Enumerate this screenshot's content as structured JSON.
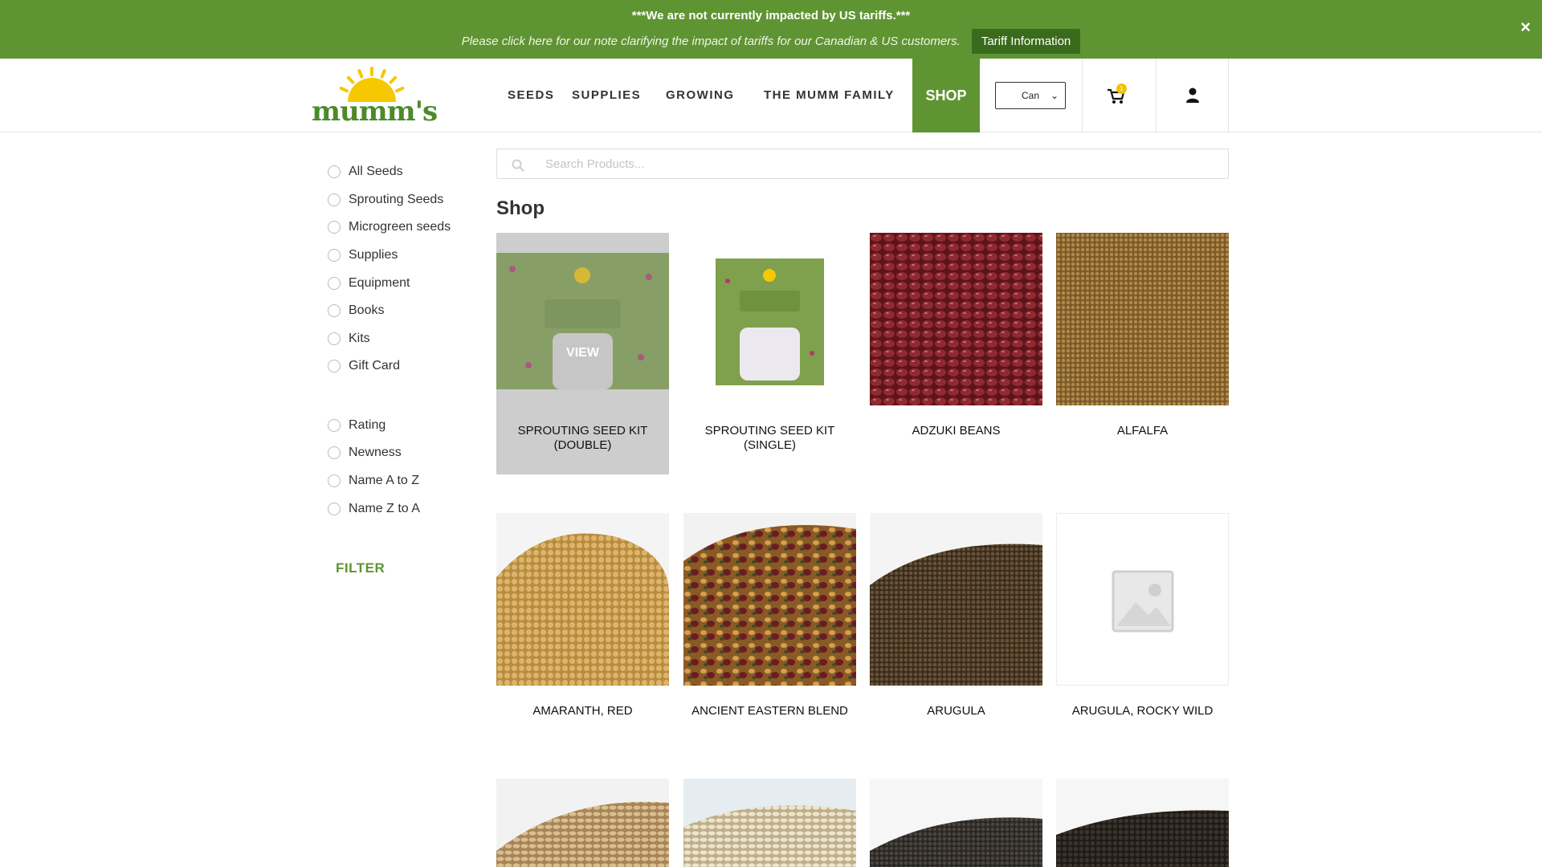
{
  "banner": {
    "headline": "***We are not currently impacted by US tariffs.***",
    "note": "Please click here for our note clarifying the impact of tariffs for our Canadian & US customers.",
    "button": "Tariff Information",
    "close": "×"
  },
  "header": {
    "logo": "mumm's",
    "nav": [
      "SEEDS",
      "SUPPLIES",
      "GROWING",
      "THE MUMM FAMILY"
    ],
    "shop": "SHOP",
    "country": "Can",
    "cart_count": "1"
  },
  "sidebar": {
    "categories": [
      "All Seeds",
      "Sprouting Seeds",
      "Microgreen seeds",
      "Supplies",
      "Equipment",
      "Books",
      "Kits",
      "Gift Card"
    ],
    "sort": [
      "Rating",
      "Newness",
      "Name A to Z",
      "Name Z to A"
    ],
    "filter": "FILTER"
  },
  "search": {
    "placeholder": "Search Products..."
  },
  "main": {
    "title": "Shop",
    "view_label": "VIEW",
    "products": [
      {
        "line1": "SPROUTING SEED KIT",
        "line2": "(DOUBLE)"
      },
      {
        "line1": "SPROUTING SEED KIT",
        "line2": "(SINGLE)"
      },
      {
        "line1": "ADZUKI BEANS",
        "line2": ""
      },
      {
        "line1": "ALFALFA",
        "line2": ""
      },
      {
        "line1": "AMARANTH, RED",
        "line2": ""
      },
      {
        "line1": "ANCIENT EASTERN BLEND",
        "line2": ""
      },
      {
        "line1": "ARUGULA",
        "line2": ""
      },
      {
        "line1": "ARUGULA, ROCKY WILD",
        "line2": ""
      }
    ]
  },
  "colors": {
    "brand_green": "#5f9432",
    "dark_green": "#3a6b1c",
    "badge_yellow": "#f2c200"
  },
  "icons": [
    "close-icon",
    "cart-icon",
    "account-icon",
    "search-icon",
    "placeholder-image-icon"
  ]
}
